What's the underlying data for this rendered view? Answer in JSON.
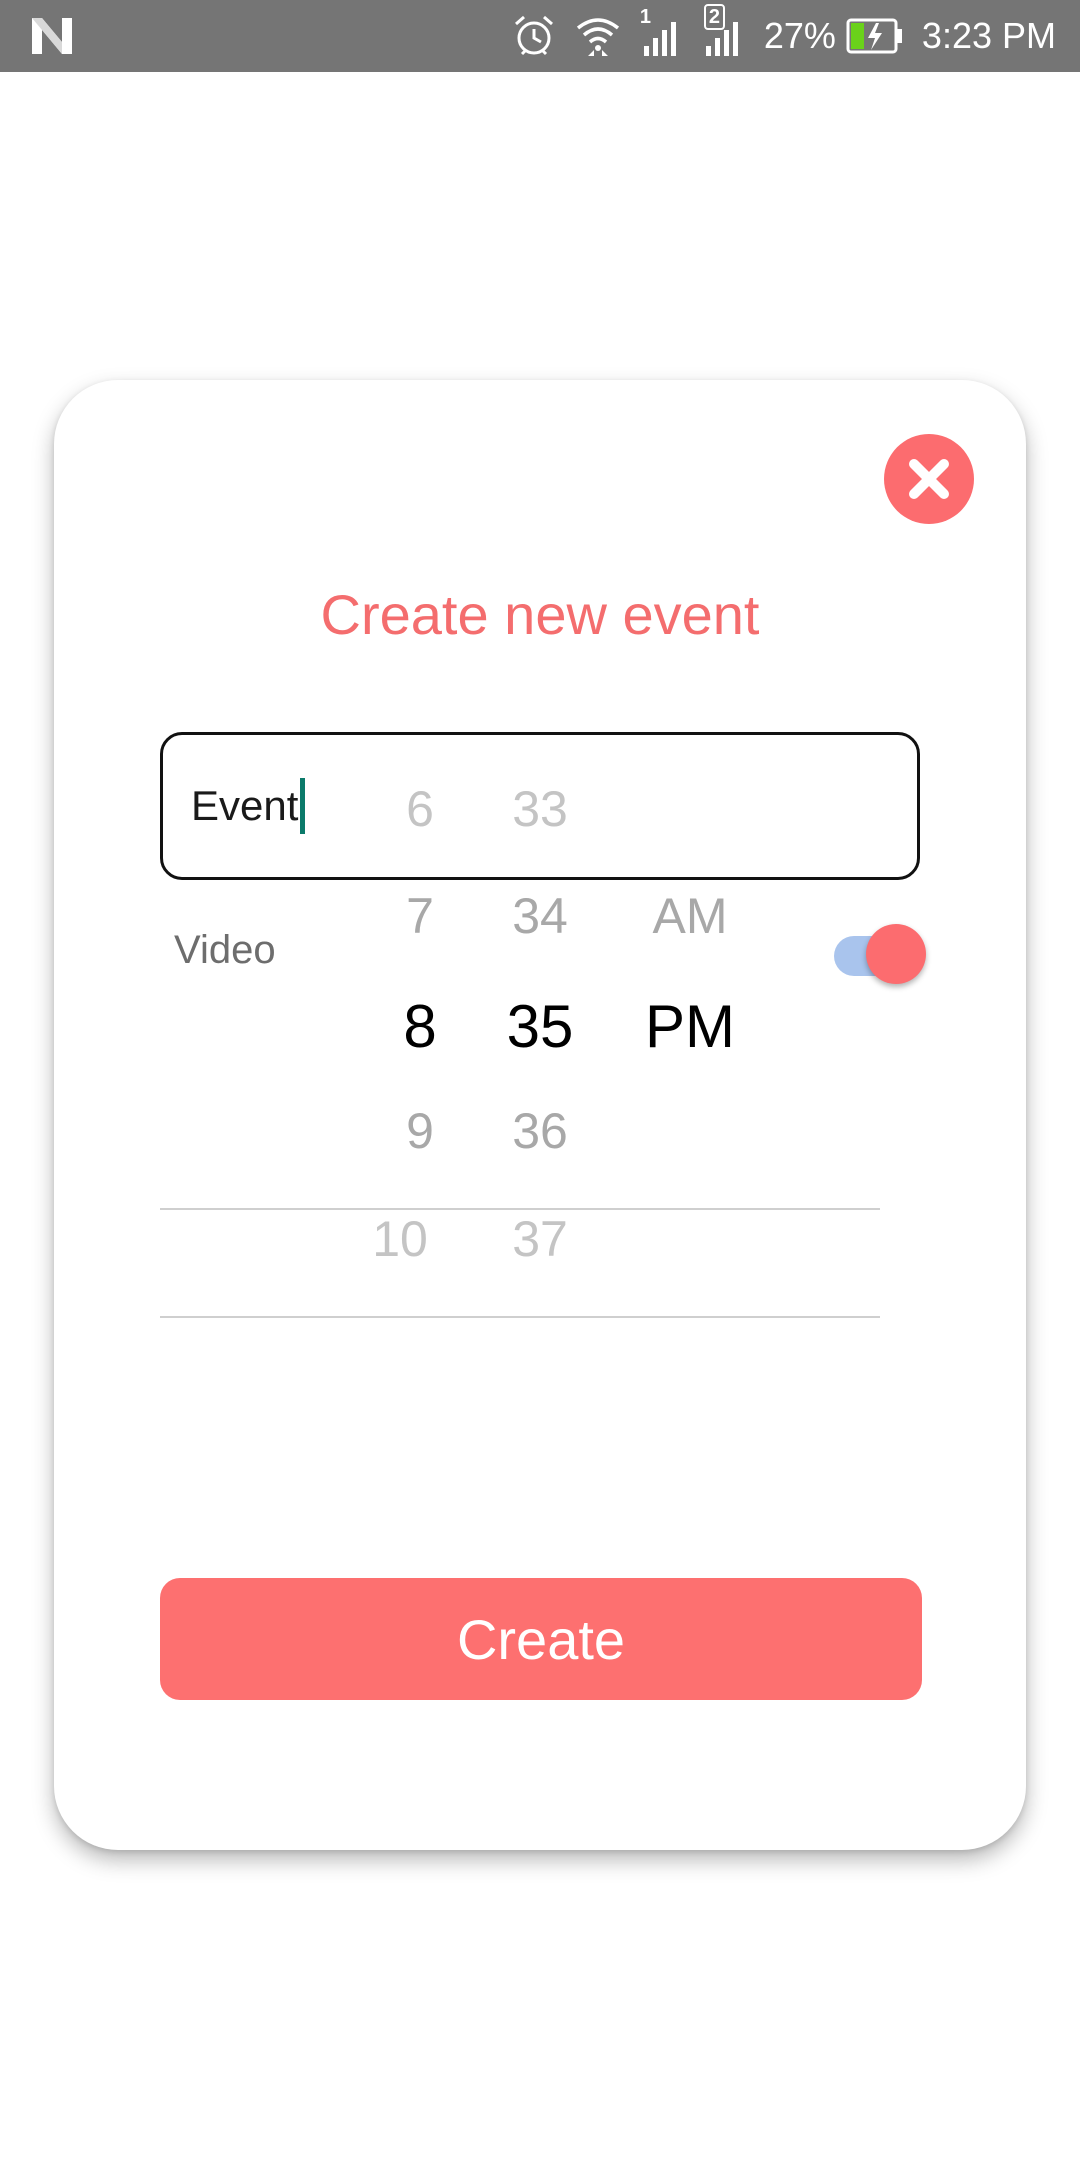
{
  "status_bar": {
    "battery_percent": "27%",
    "time": "3:23 PM",
    "sim1_badge": "1",
    "sim2_badge": "2",
    "icons": [
      "notification-n-icon",
      "alarm-icon",
      "wifi-icon",
      "signal-sim1-icon",
      "signal-sim2-icon",
      "battery-charging-icon"
    ]
  },
  "dialog": {
    "title": "Create new event",
    "event_input_value": "Event",
    "video_label": "Video",
    "video_toggle_on": true,
    "create_label": "Create",
    "close_icon": "close-icon"
  },
  "time_picker": {
    "hours": [
      "6",
      "7",
      "8",
      "9",
      "10"
    ],
    "minutes": [
      "33",
      "34",
      "35",
      "36",
      "37"
    ],
    "ampm": [
      "AM",
      "PM"
    ],
    "selected": {
      "hour": "8",
      "minute": "35",
      "ampm": "PM"
    }
  },
  "colors": {
    "accent": "#fc6c6f",
    "status_bar": "#757575",
    "toggle_track": "#a9c4ed",
    "caret": "#0b7a6a"
  }
}
